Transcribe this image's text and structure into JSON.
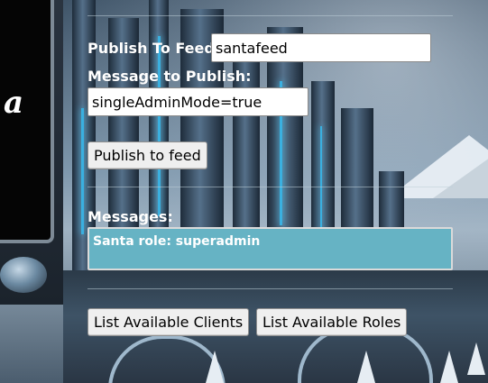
{
  "feed": {
    "label": "Publish To Feed:",
    "value": "santafeed"
  },
  "message": {
    "label": "Message to Publish:",
    "value": "singleAdminMode=true"
  },
  "publish_button": "Publish to feed",
  "messages": {
    "label": "Messages:",
    "items": [
      "Santa role: superadmin"
    ]
  },
  "actions": {
    "list_clients": "List Available Clients",
    "list_roles": "List Available Roles"
  },
  "colors": {
    "message_box": "#66b3c4",
    "label_text": "#ffffff"
  }
}
